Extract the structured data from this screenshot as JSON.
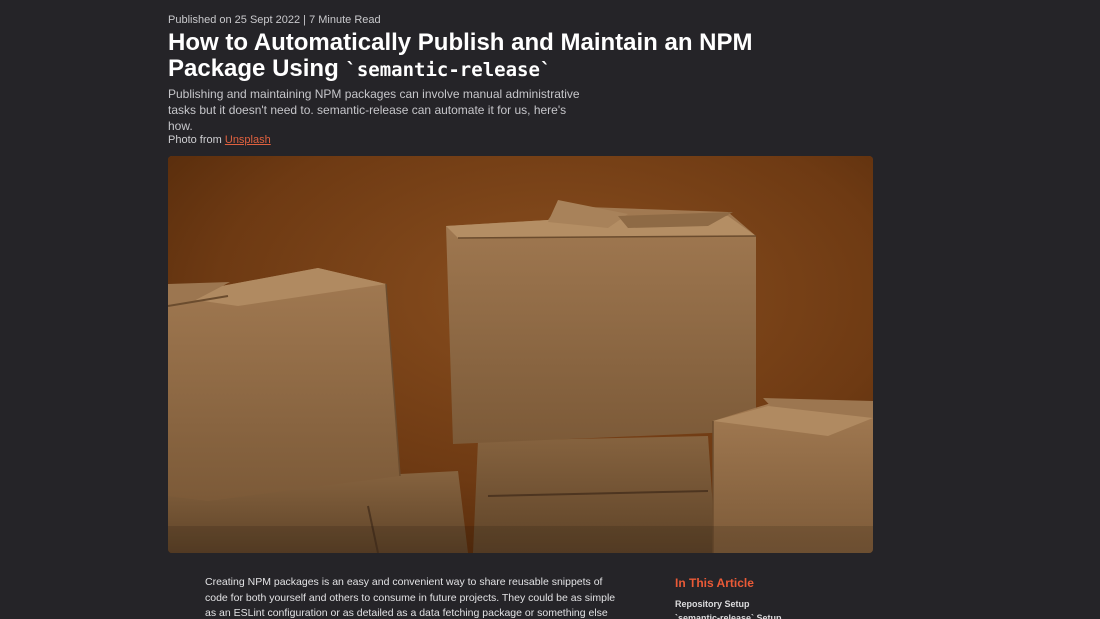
{
  "header": {
    "meta": "Published on 25 Sept 2022 | 7 Minute Read",
    "title_prefix": "How to Automatically Publish and Maintain an NPM Package Using",
    "title_code": "`semantic-release`",
    "subtitle": "Publishing and maintaining NPM packages can involve manual administrative tasks but it doesn't need to. semantic-release can automate it for us, here's how."
  },
  "photo": {
    "credit_prefix": "Photo from",
    "credit_link": "Unsplash"
  },
  "article": {
    "intro": "Creating NPM packages is an easy and convenient way to share reusable snippets of code for both yourself and others to consume in future projects. They could be as simple as an ESLint configuration or as detailed as a data fetching package or something else entirely. But, for the"
  },
  "toc": {
    "title": "In This Article",
    "items": [
      "Repository Setup",
      "`semantic-release` Setup"
    ]
  },
  "colors": {
    "background": "#252428",
    "accent": "#e0613f",
    "toc_heading": "#ea5a37"
  }
}
